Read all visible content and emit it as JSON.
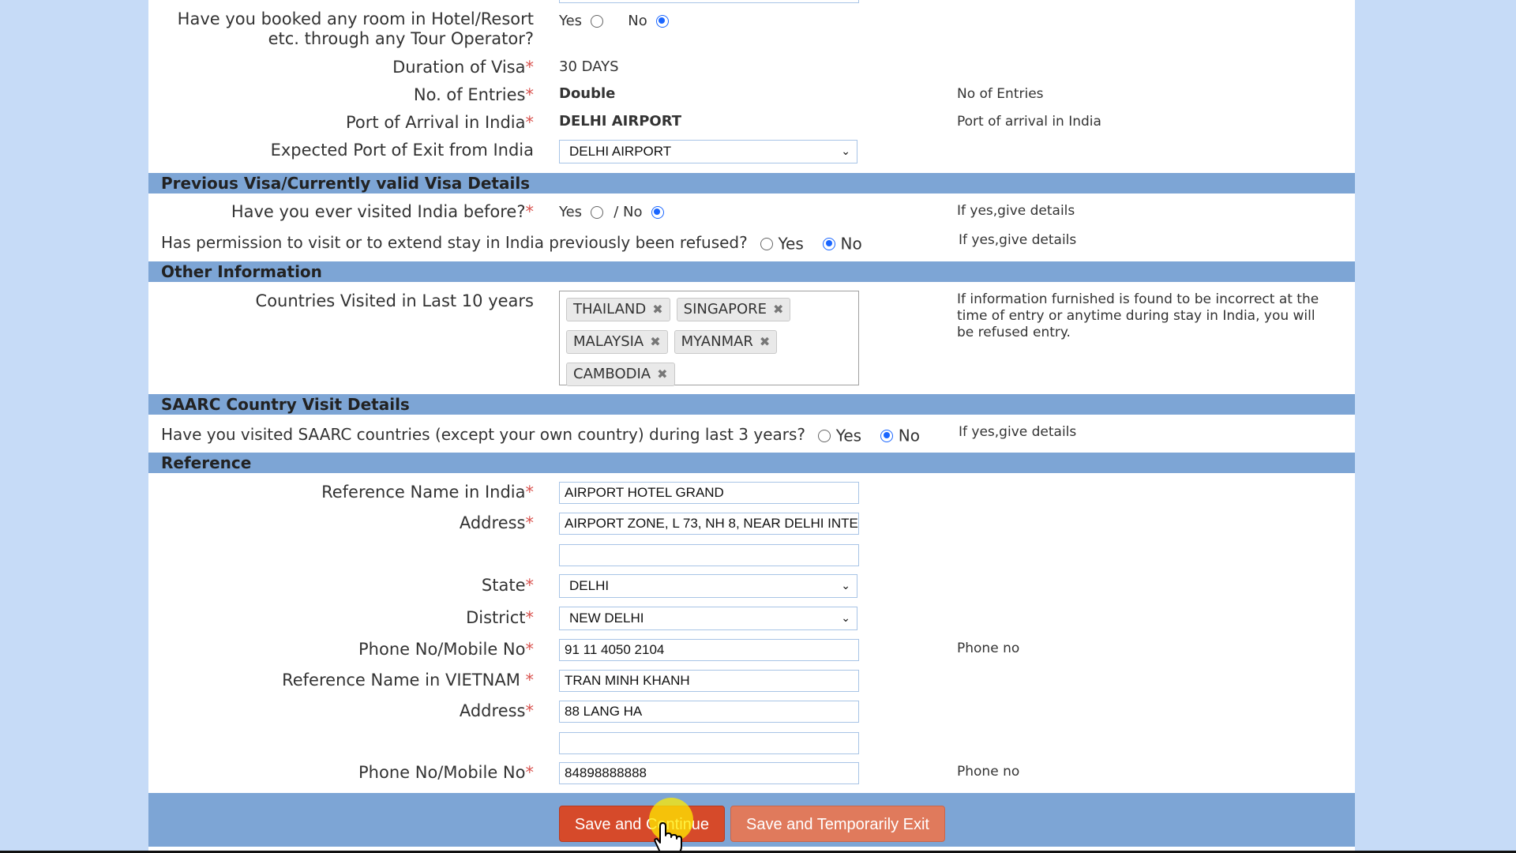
{
  "travel": {
    "hotel_q_line1": "Have you booked any room in Hotel/Resort",
    "hotel_q_line2": "etc. through any Tour Operator?",
    "yes": "Yes",
    "no": "No",
    "hotel_answer": "No",
    "duration_label": "Duration of Visa",
    "duration_value": "30 DAYS",
    "entries_label": "No. of Entries",
    "entries_value": "Double",
    "entries_hint": "No of Entries",
    "arrival_label": "Port of Arrival in India",
    "arrival_value": "DELHI AIRPORT",
    "arrival_hint": "Port of arrival in India",
    "exit_label": "Expected Port of Exit from India",
    "exit_value": "DELHI AIRPORT"
  },
  "previous_visa": {
    "header": "Previous Visa/Currently valid Visa Details",
    "visited_q": "Have you ever visited India before?",
    "yes": "Yes",
    "sep_no": "/ No",
    "visited_answer": "No",
    "visited_hint": "If yes,give details",
    "refused_q": "Has permission to visit or to extend stay in India previously been refused?",
    "refused_yes": "Yes",
    "refused_no": "No",
    "refused_answer": "No",
    "refused_hint": "If yes,give details"
  },
  "other_info": {
    "header": "Other Information",
    "countries_label": "Countries Visited in Last 10 years",
    "countries": [
      "THAILAND",
      "SINGAPORE",
      "MALAYSIA",
      "MYANMAR",
      "CAMBODIA"
    ],
    "warning": "If information furnished is found to be incorrect at the time of entry or anytime during stay in India, you will be refused entry."
  },
  "saarc": {
    "header": "SAARC Country Visit Details",
    "question": "Have you visited SAARC countries (except your own country) during last 3 years?",
    "yes": "Yes",
    "no": "No",
    "answer": "No",
    "hint": "If yes,give details"
  },
  "reference": {
    "header": "Reference",
    "name_india_label": "Reference Name in India",
    "name_india_value": "AIRPORT HOTEL GRAND",
    "address_label": "Address",
    "address_value": "AIRPORT ZONE, L 73, NH 8, NEAR DELHI INTE",
    "address2_value": "",
    "state_label": "State",
    "state_value": "DELHI",
    "district_label": "District",
    "district_value": "NEW DELHI",
    "phone_label": "Phone No/Mobile No",
    "phone_value": "91 11 4050 2104",
    "phone_hint": "Phone no",
    "name_home_label": "Reference Name in VIETNAM ",
    "name_home_value": "TRAN MINH KHANH",
    "home_address_label": "Address",
    "home_address_value": "88 LANG HA",
    "home_address2_value": "",
    "home_phone_label": "Phone No/Mobile No",
    "home_phone_value": "84898888888",
    "home_phone_hint": "Phone no",
    "required_mark": "*"
  },
  "actions": {
    "save_continue": "Save and Continue",
    "save_exit": "Save and Temporarily Exit"
  },
  "colors": {
    "page_bg": "#c6dbf7",
    "section_bar": "#7da5d5",
    "required": "#d9534f",
    "primary_button": "#d64a2a",
    "secondary_button": "#e07a5c",
    "radio_selected": "#1a66ff"
  }
}
